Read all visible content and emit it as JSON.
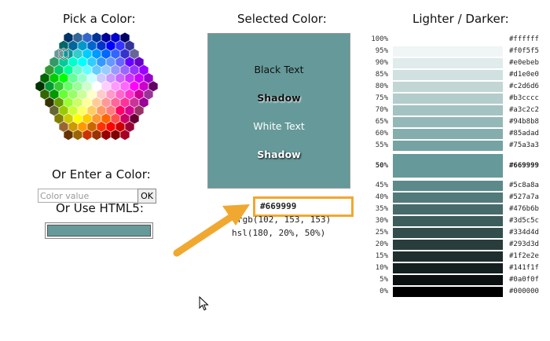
{
  "headers": {
    "pick": "Pick a Color:",
    "selected": "Selected Color:",
    "lighter_darker": "Lighter / Darker:",
    "enter": "Or Enter a Color:",
    "html5": "Or Use HTML5:"
  },
  "input": {
    "placeholder": "Color value",
    "ok_label": "OK"
  },
  "preview": {
    "bg": "#669999",
    "black_text": "Black Text",
    "shadow_dark": "Shadow",
    "white_text": "White Text",
    "shadow_light": "Shadow"
  },
  "values": {
    "hex": "#669999",
    "rgb": "rgb(102, 153, 153)",
    "hsl": "hsl(180, 20%, 50%)"
  },
  "html5_swatch": "#669999",
  "accent": "#f0a830",
  "hex_colors": [
    [
      "#003366",
      "#336699",
      "#3366cc",
      "#003399",
      "#000099",
      "#0000cc",
      "#000066"
    ],
    [
      "#006666",
      "#006699",
      "#0099cc",
      "#0066cc",
      "#0033cc",
      "#0000ff",
      "#3333ff",
      "#333399"
    ],
    [
      "#669999",
      "#009999",
      "#33cccc",
      "#00ccff",
      "#0099ff",
      "#0066ff",
      "#3366ff",
      "#3333cc",
      "#666699"
    ],
    [
      "#339966",
      "#00cc99",
      "#00ffcc",
      "#00ffff",
      "#33ccff",
      "#3399ff",
      "#6699ff",
      "#6666ff",
      "#6600ff",
      "#6600cc"
    ],
    [
      "#339933",
      "#00cc66",
      "#00ff99",
      "#66ffcc",
      "#66ffff",
      "#66ccff",
      "#99ccff",
      "#9999ff",
      "#9966ff",
      "#9933ff",
      "#9900ff"
    ],
    [
      "#006600",
      "#00cc00",
      "#00ff00",
      "#66ff99",
      "#99ffcc",
      "#ccffff",
      "#ccccff",
      "#cc99ff",
      "#cc66ff",
      "#cc33ff",
      "#cc00ff",
      "#9900cc"
    ],
    [
      "#003300",
      "#009933",
      "#33cc33",
      "#66ff66",
      "#99ff99",
      "#ccffcc",
      "#ffffff",
      "#ffccff",
      "#ff99ff",
      "#ff66ff",
      "#ff00ff",
      "#cc00cc",
      "#660066"
    ],
    [
      "#336600",
      "#009900",
      "#66ff33",
      "#99ff66",
      "#ccff99",
      "#ffffcc",
      "#ffcccc",
      "#ff99cc",
      "#ff66cc",
      "#ff33cc",
      "#cc0099",
      "#993399"
    ],
    [
      "#333300",
      "#669900",
      "#99ff33",
      "#ccff66",
      "#ffff99",
      "#ffcc99",
      "#ff9999",
      "#ff6699",
      "#ff3399",
      "#cc3399",
      "#990099"
    ],
    [
      "#666633",
      "#99cc00",
      "#ccff33",
      "#ffff66",
      "#ffcc66",
      "#ff9966",
      "#ff7c80",
      "#ff0066",
      "#d60093",
      "#993366"
    ],
    [
      "#808000",
      "#cccc00",
      "#ffff00",
      "#ffcc00",
      "#ff9933",
      "#ff6600",
      "#ff5050",
      "#cc0066",
      "#660033"
    ],
    [
      "#996633",
      "#cc9900",
      "#ff9900",
      "#cc6600",
      "#ff3300",
      "#ff0000",
      "#cc0000",
      "#990033"
    ],
    [
      "#663300",
      "#996600",
      "#cc3300",
      "#993300",
      "#990000",
      "#800000",
      "#a50021"
    ]
  ],
  "shades": [
    {
      "pct": "100%",
      "hex": "#ffffff",
      "color": "#ffffff"
    },
    {
      "pct": "95%",
      "hex": "#f0f5f5",
      "color": "#f0f5f5"
    },
    {
      "pct": "90%",
      "hex": "#e0ebeb",
      "color": "#e0ebeb"
    },
    {
      "pct": "85%",
      "hex": "#d1e0e0",
      "color": "#d1e0e0"
    },
    {
      "pct": "80%",
      "hex": "#c2d6d6",
      "color": "#c2d6d6"
    },
    {
      "pct": "75%",
      "hex": "#b3cccc",
      "color": "#b3cccc"
    },
    {
      "pct": "70%",
      "hex": "#a3c2c2",
      "color": "#a3c2c2"
    },
    {
      "pct": "65%",
      "hex": "#94b8b8",
      "color": "#94b8b8"
    },
    {
      "pct": "60%",
      "hex": "#85adad",
      "color": "#85adad"
    },
    {
      "pct": "55%",
      "hex": "#75a3a3",
      "color": "#75a3a3"
    },
    {
      "pct": "50%",
      "hex": "#669999",
      "color": "#669999",
      "bold": true
    },
    {
      "pct": "45%",
      "hex": "#5c8a8a",
      "color": "#5c8a8a"
    },
    {
      "pct": "40%",
      "hex": "#527a7a",
      "color": "#527a7a"
    },
    {
      "pct": "35%",
      "hex": "#476b6b",
      "color": "#476b6b"
    },
    {
      "pct": "30%",
      "hex": "#3d5c5c",
      "color": "#3d5c5c"
    },
    {
      "pct": "25%",
      "hex": "#334d4d",
      "color": "#334d4d"
    },
    {
      "pct": "20%",
      "hex": "#293d3d",
      "color": "#293d3d"
    },
    {
      "pct": "15%",
      "hex": "#1f2e2e",
      "color": "#1f2e2e"
    },
    {
      "pct": "10%",
      "hex": "#141f1f",
      "color": "#141f1f"
    },
    {
      "pct": "5%",
      "hex": "#0a0f0f",
      "color": "#0a0f0f"
    },
    {
      "pct": "0%",
      "hex": "#000000",
      "color": "#000000"
    }
  ]
}
